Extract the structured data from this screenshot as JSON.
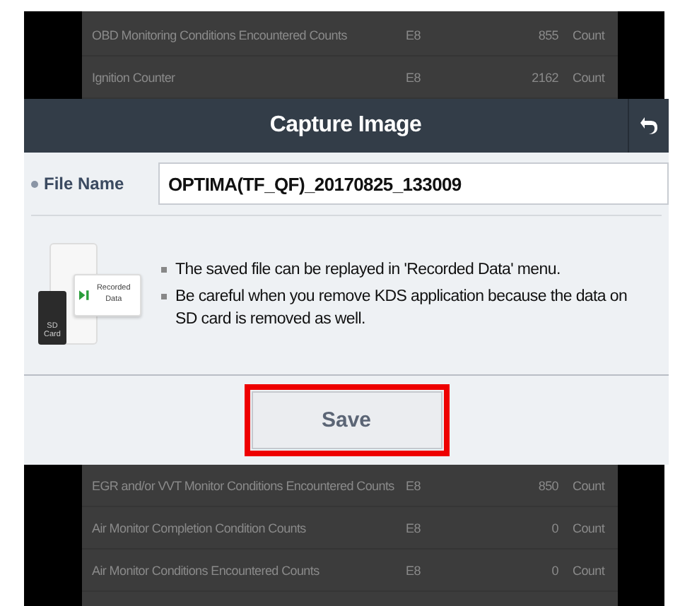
{
  "background_table": {
    "rows_above": [
      {
        "name": "OBD Monitoring Conditions Encountered Counts",
        "unit": "E8",
        "value": "855",
        "measure": "Count"
      },
      {
        "name": "Ignition Counter",
        "unit": "E8",
        "value": "2162",
        "measure": "Count"
      }
    ],
    "rows_below": [
      {
        "name": "EGR and/or VVT Monitor Conditions Encountered Counts",
        "unit": "E8",
        "value": "850",
        "measure": "Count"
      },
      {
        "name": "Air Monitor Completion Condition Counts",
        "unit": "E8",
        "value": "0",
        "measure": "Count"
      },
      {
        "name": "Air Monitor Conditions Encountered Counts",
        "unit": "E8",
        "value": "0",
        "measure": "Count"
      }
    ]
  },
  "dialog": {
    "title": "Capture Image",
    "file_name": {
      "label": "File Name",
      "value": "OPTIMA(TF_QF)_20170825_133009"
    },
    "illustration": {
      "card_label": "SD Card",
      "badge_label": "Recorded Data"
    },
    "notes": [
      "The saved file can be replayed in 'Recorded Data' menu.",
      "Be careful when you remove KDS application because the data on SD card is removed as well."
    ],
    "save_button": {
      "label": "Save",
      "highlighted": true
    }
  }
}
